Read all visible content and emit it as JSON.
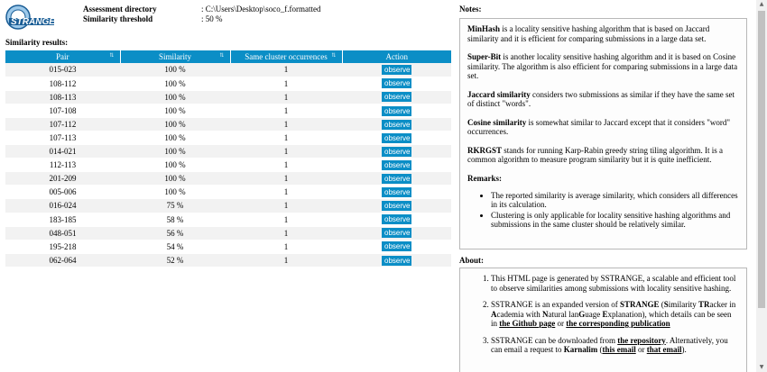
{
  "header": {
    "logo_text": "STRANGE",
    "assessment_label": "Assessment directory",
    "assessment_value": ": C:\\Users\\Desktop\\soco_f.formatted",
    "threshold_label": "Similarity threshold",
    "threshold_value": ": 50 %"
  },
  "results": {
    "title": "Similarity results:",
    "columns": [
      "Pair",
      "Similarity",
      "Same cluster occurrences",
      "Action"
    ],
    "sort_icon": "⇅",
    "button_label": "observe",
    "rows": [
      {
        "pair": "015-023",
        "similarity": "100 %",
        "occurrences": "1"
      },
      {
        "pair": "108-112",
        "similarity": "100 %",
        "occurrences": "1"
      },
      {
        "pair": "108-113",
        "similarity": "100 %",
        "occurrences": "1"
      },
      {
        "pair": "107-108",
        "similarity": "100 %",
        "occurrences": "1"
      },
      {
        "pair": "107-112",
        "similarity": "100 %",
        "occurrences": "1"
      },
      {
        "pair": "107-113",
        "similarity": "100 %",
        "occurrences": "1"
      },
      {
        "pair": "014-021",
        "similarity": "100 %",
        "occurrences": "1"
      },
      {
        "pair": "112-113",
        "similarity": "100 %",
        "occurrences": "1"
      },
      {
        "pair": "201-209",
        "similarity": "100 %",
        "occurrences": "1"
      },
      {
        "pair": "005-006",
        "similarity": "100 %",
        "occurrences": "1"
      },
      {
        "pair": "016-024",
        "similarity": "75 %",
        "occurrences": "1"
      },
      {
        "pair": "183-185",
        "similarity": "58 %",
        "occurrences": "1"
      },
      {
        "pair": "048-051",
        "similarity": "56 %",
        "occurrences": "1"
      },
      {
        "pair": "195-218",
        "similarity": "54 %",
        "occurrences": "1"
      },
      {
        "pair": "062-064",
        "similarity": "52 %",
        "occurrences": "1"
      }
    ]
  },
  "notes": {
    "title": "Notes:",
    "minhash_term": "MinHash",
    "minhash_text": " is a locality sensitive hashing algorithm that is based on Jaccard similarity and it is efficient for comparing submissions in a large data set.",
    "superbit_term": "Super-Bit",
    "superbit_text": " is another locality sensitive hashing algorithm and it is based on Cosine similarity. The algorithm is also efficient for comparing submissions in a large data set.",
    "jaccard_term": "Jaccard similarity",
    "jaccard_text": " considers two submissions as similar if they have the same set of distinct \"words\".",
    "cosine_term": "Cosine similarity",
    "cosine_text": " is somewhat similar to Jaccard except that it considers \"word\" occurrences.",
    "rkrgst_term": "RKRGST",
    "rkrgst_text": " stands for running Karp-Rabin greedy string tiling algorithm. It is a common algorithm to measure program similarity but it is quite inefficient.",
    "remarks_title": "Remarks:",
    "remarks": [
      "The reported similarity is average similarity, which considers all differences in its calculation.",
      "Clustering is only applicable for locality sensitive hashing algorithms and submissions in the same cluster should be relatively similar."
    ]
  },
  "about": {
    "title": "About:",
    "item1": "This HTML page is generated by SSTRANGE, a scalable and efficient tool to observe similarities among submissions with locality sensitive hashing.",
    "item2_a": "SSTRANGE is an expanded version of ",
    "item2_strange": "STRANGE",
    "item2_b": " (",
    "item2_s": "S",
    "item2_c": "imilarity ",
    "item2_tr": "TR",
    "item2_d": "acker in ",
    "item2_a2": "A",
    "item2_e": "cademia with ",
    "item2_n": "N",
    "item2_f": "atural lan",
    "item2_g": "G",
    "item2_g2": "uage ",
    "item2_ex": "E",
    "item2_h": "xplanation), which details can be seen in ",
    "item2_link1": "the Github page",
    "item2_or": " or ",
    "item2_link2": "the corresponding publication",
    "item3_a": "SSTRANGE can be downloaded from ",
    "item3_link1": "the repository",
    "item3_b": ". Alternatively, you can email a request to ",
    "item3_name": "Karnalim",
    "item3_c": " (",
    "item3_link2": "this email",
    "item3_or": " or ",
    "item3_link3": "that email",
    "item3_d": ")."
  }
}
